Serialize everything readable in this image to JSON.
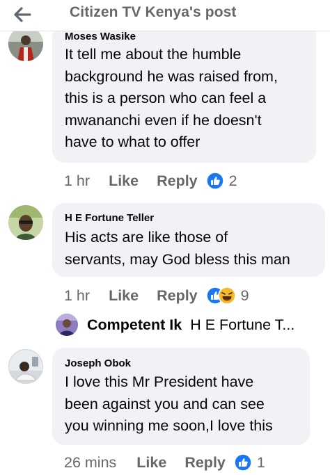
{
  "header": {
    "title": "Citizen TV Kenya's post"
  },
  "comments": [
    {
      "author": "Moses Wasike",
      "text": "It tell me about the humble\nbackground he was raised from,\nthis is a person who can feel a\nmwananchi even if he doesn't\nhave to what to offer",
      "time": "1 hr",
      "like_label": "Like",
      "reply_label": "Reply",
      "reaction_count": "2",
      "reactions": [
        "like"
      ]
    },
    {
      "author": "H E Fortune Teller",
      "text": "His acts are like those of\nservants, may God bless this man",
      "time": "1 hr",
      "like_label": "Like",
      "reply_label": "Reply",
      "reaction_count": "9",
      "reactions": [
        "like",
        "haha"
      ]
    },
    {
      "author": "Joseph Obok",
      "text": "I love this Mr President have\nbeen against you and  can see\nyou winning me soon,I love this",
      "time": "26 mins",
      "like_label": "Like",
      "reply_label": "Reply",
      "reaction_count": "1",
      "reactions": [
        "like"
      ]
    }
  ],
  "reply_preview": {
    "author": "Competent Ik",
    "text": "H E Fortune T..."
  },
  "colors": {
    "like_blue": "#1877f2",
    "haha_yellow": "#f7b928",
    "secondary_text": "#65676b",
    "bubble_bg": "#f0f2f5"
  },
  "icons": {
    "back": "arrow-left-icon",
    "like_reaction": "thumbs-up-icon",
    "haha_reaction": "laughing-face-icon"
  }
}
